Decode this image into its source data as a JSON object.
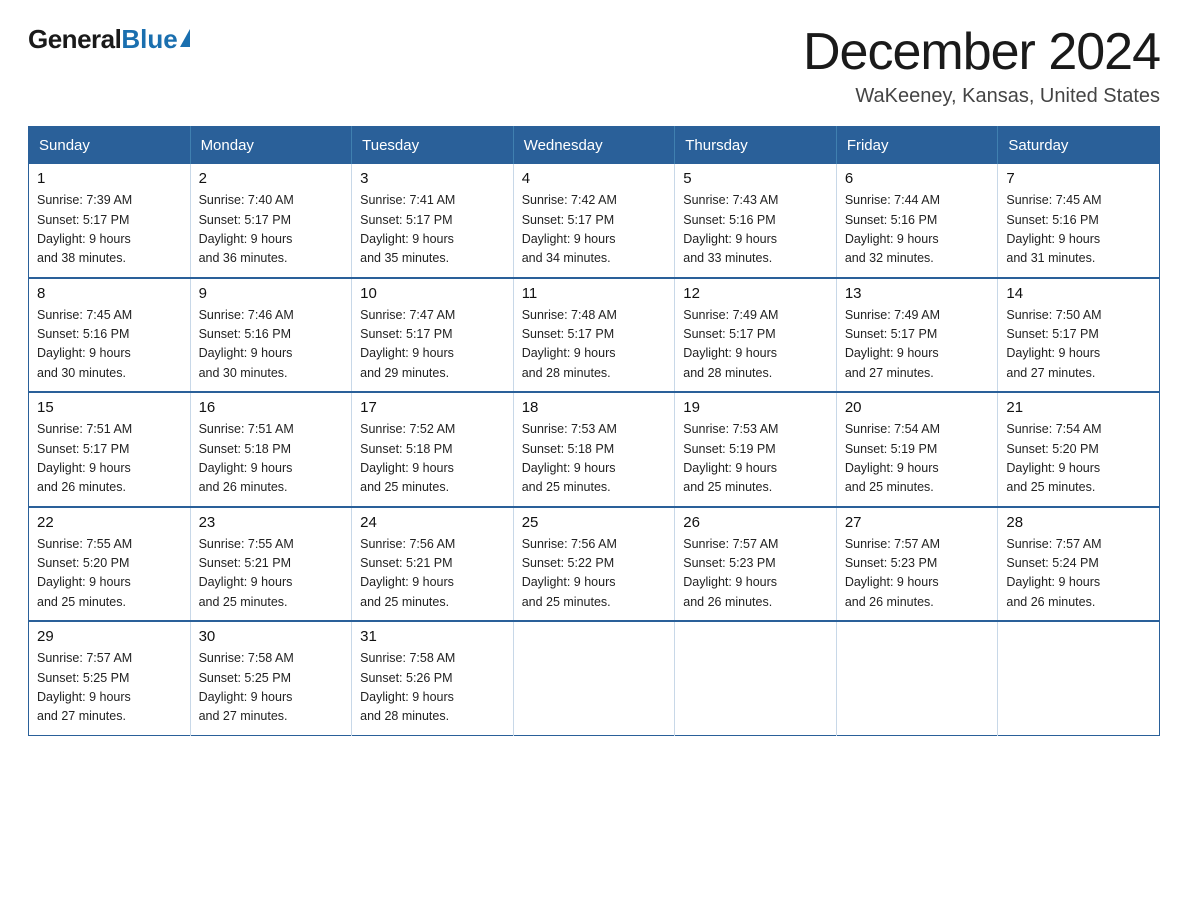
{
  "header": {
    "logo_general": "General",
    "logo_blue": "Blue",
    "title": "December 2024",
    "subtitle": "WaKeeney, Kansas, United States"
  },
  "weekdays": [
    "Sunday",
    "Monday",
    "Tuesday",
    "Wednesday",
    "Thursday",
    "Friday",
    "Saturday"
  ],
  "weeks": [
    [
      {
        "day": "1",
        "sunrise": "7:39 AM",
        "sunset": "5:17 PM",
        "daylight": "9 hours and 38 minutes."
      },
      {
        "day": "2",
        "sunrise": "7:40 AM",
        "sunset": "5:17 PM",
        "daylight": "9 hours and 36 minutes."
      },
      {
        "day": "3",
        "sunrise": "7:41 AM",
        "sunset": "5:17 PM",
        "daylight": "9 hours and 35 minutes."
      },
      {
        "day": "4",
        "sunrise": "7:42 AM",
        "sunset": "5:17 PM",
        "daylight": "9 hours and 34 minutes."
      },
      {
        "day": "5",
        "sunrise": "7:43 AM",
        "sunset": "5:16 PM",
        "daylight": "9 hours and 33 minutes."
      },
      {
        "day": "6",
        "sunrise": "7:44 AM",
        "sunset": "5:16 PM",
        "daylight": "9 hours and 32 minutes."
      },
      {
        "day": "7",
        "sunrise": "7:45 AM",
        "sunset": "5:16 PM",
        "daylight": "9 hours and 31 minutes."
      }
    ],
    [
      {
        "day": "8",
        "sunrise": "7:45 AM",
        "sunset": "5:16 PM",
        "daylight": "9 hours and 30 minutes."
      },
      {
        "day": "9",
        "sunrise": "7:46 AM",
        "sunset": "5:16 PM",
        "daylight": "9 hours and 30 minutes."
      },
      {
        "day": "10",
        "sunrise": "7:47 AM",
        "sunset": "5:17 PM",
        "daylight": "9 hours and 29 minutes."
      },
      {
        "day": "11",
        "sunrise": "7:48 AM",
        "sunset": "5:17 PM",
        "daylight": "9 hours and 28 minutes."
      },
      {
        "day": "12",
        "sunrise": "7:49 AM",
        "sunset": "5:17 PM",
        "daylight": "9 hours and 28 minutes."
      },
      {
        "day": "13",
        "sunrise": "7:49 AM",
        "sunset": "5:17 PM",
        "daylight": "9 hours and 27 minutes."
      },
      {
        "day": "14",
        "sunrise": "7:50 AM",
        "sunset": "5:17 PM",
        "daylight": "9 hours and 27 minutes."
      }
    ],
    [
      {
        "day": "15",
        "sunrise": "7:51 AM",
        "sunset": "5:17 PM",
        "daylight": "9 hours and 26 minutes."
      },
      {
        "day": "16",
        "sunrise": "7:51 AM",
        "sunset": "5:18 PM",
        "daylight": "9 hours and 26 minutes."
      },
      {
        "day": "17",
        "sunrise": "7:52 AM",
        "sunset": "5:18 PM",
        "daylight": "9 hours and 25 minutes."
      },
      {
        "day": "18",
        "sunrise": "7:53 AM",
        "sunset": "5:18 PM",
        "daylight": "9 hours and 25 minutes."
      },
      {
        "day": "19",
        "sunrise": "7:53 AM",
        "sunset": "5:19 PM",
        "daylight": "9 hours and 25 minutes."
      },
      {
        "day": "20",
        "sunrise": "7:54 AM",
        "sunset": "5:19 PM",
        "daylight": "9 hours and 25 minutes."
      },
      {
        "day": "21",
        "sunrise": "7:54 AM",
        "sunset": "5:20 PM",
        "daylight": "9 hours and 25 minutes."
      }
    ],
    [
      {
        "day": "22",
        "sunrise": "7:55 AM",
        "sunset": "5:20 PM",
        "daylight": "9 hours and 25 minutes."
      },
      {
        "day": "23",
        "sunrise": "7:55 AM",
        "sunset": "5:21 PM",
        "daylight": "9 hours and 25 minutes."
      },
      {
        "day": "24",
        "sunrise": "7:56 AM",
        "sunset": "5:21 PM",
        "daylight": "9 hours and 25 minutes."
      },
      {
        "day": "25",
        "sunrise": "7:56 AM",
        "sunset": "5:22 PM",
        "daylight": "9 hours and 25 minutes."
      },
      {
        "day": "26",
        "sunrise": "7:57 AM",
        "sunset": "5:23 PM",
        "daylight": "9 hours and 26 minutes."
      },
      {
        "day": "27",
        "sunrise": "7:57 AM",
        "sunset": "5:23 PM",
        "daylight": "9 hours and 26 minutes."
      },
      {
        "day": "28",
        "sunrise": "7:57 AM",
        "sunset": "5:24 PM",
        "daylight": "9 hours and 26 minutes."
      }
    ],
    [
      {
        "day": "29",
        "sunrise": "7:57 AM",
        "sunset": "5:25 PM",
        "daylight": "9 hours and 27 minutes."
      },
      {
        "day": "30",
        "sunrise": "7:58 AM",
        "sunset": "5:25 PM",
        "daylight": "9 hours and 27 minutes."
      },
      {
        "day": "31",
        "sunrise": "7:58 AM",
        "sunset": "5:26 PM",
        "daylight": "9 hours and 28 minutes."
      },
      null,
      null,
      null,
      null
    ]
  ],
  "labels": {
    "sunrise_prefix": "Sunrise: ",
    "sunset_prefix": "Sunset: ",
    "daylight_prefix": "Daylight: "
  }
}
